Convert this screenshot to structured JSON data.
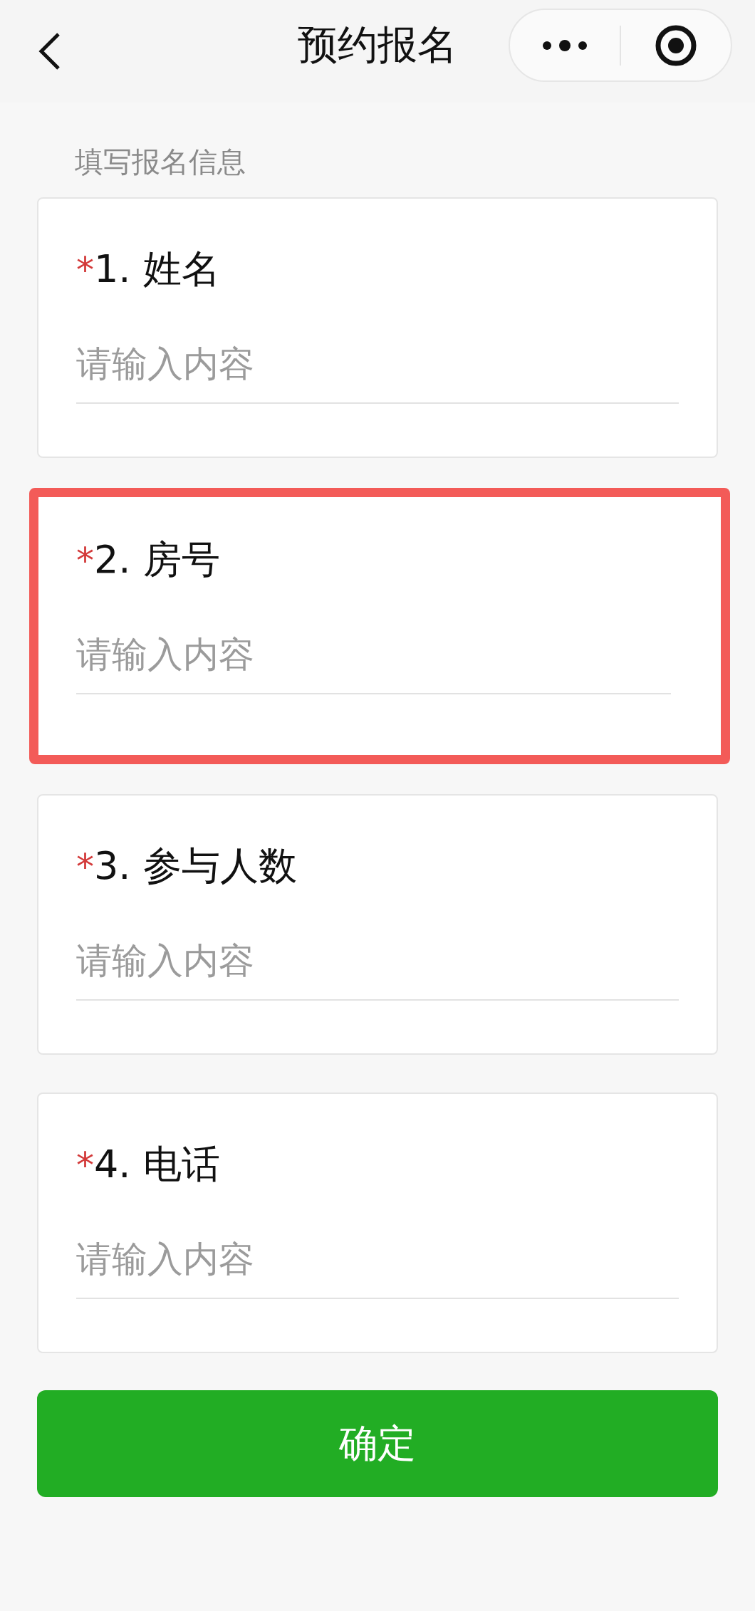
{
  "header": {
    "title": "预约报名"
  },
  "section_title": "填写报名信息",
  "fields": [
    {
      "mark": "*",
      "label": "1. 姓名",
      "placeholder": "请输入内容",
      "highlighted": false
    },
    {
      "mark": "*",
      "label": "2. 房号",
      "placeholder": "请输入内容",
      "highlighted": true
    },
    {
      "mark": "*",
      "label": "3. 参与人数",
      "placeholder": "请输入内容",
      "highlighted": false
    },
    {
      "mark": "*",
      "label": "4. 电话",
      "placeholder": "请输入内容",
      "highlighted": false
    }
  ],
  "submit": "确定"
}
